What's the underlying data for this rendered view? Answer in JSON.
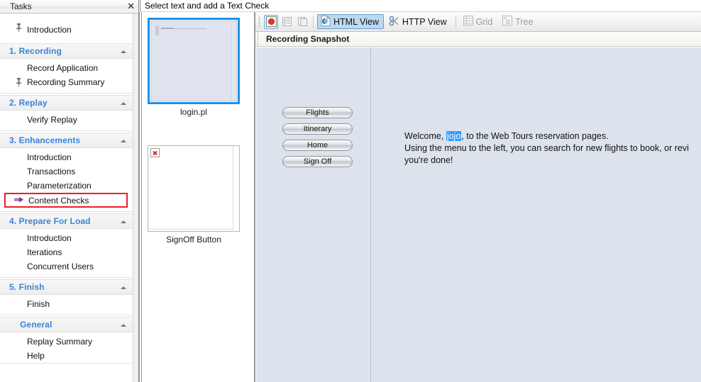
{
  "tasks_pane": {
    "title": "Tasks",
    "close_icon": "close-icon",
    "items_flat": [
      {
        "label": "Introduction",
        "icon": "pin-icon",
        "type": "item"
      }
    ],
    "groups": [
      {
        "title": "1. Recording",
        "collapse_icon": "chevron-up-icon",
        "items": [
          {
            "label": "Record Application",
            "icon": ""
          },
          {
            "label": "Recording Summary",
            "icon": "pin-icon"
          }
        ]
      },
      {
        "title": "2. Replay",
        "collapse_icon": "chevron-up-icon",
        "items": [
          {
            "label": "Verify Replay",
            "icon": ""
          }
        ]
      },
      {
        "title": "3. Enhancements",
        "collapse_icon": "chevron-up-icon",
        "items": [
          {
            "label": "Introduction",
            "icon": ""
          },
          {
            "label": "Transactions",
            "icon": ""
          },
          {
            "label": "Parameterization",
            "icon": ""
          },
          {
            "label": "Content Checks",
            "icon": "arrow-right-icon",
            "highlighted": true
          }
        ]
      },
      {
        "title": "4. Prepare For Load",
        "collapse_icon": "chevron-up-icon",
        "items": [
          {
            "label": "Introduction",
            "icon": ""
          },
          {
            "label": "Iterations",
            "icon": ""
          },
          {
            "label": "Concurrent Users",
            "icon": ""
          }
        ]
      },
      {
        "title": "5. Finish",
        "collapse_icon": "chevron-up-icon",
        "items": [
          {
            "label": "Finish",
            "icon": ""
          }
        ]
      },
      {
        "title": "General",
        "collapse_icon": "chevron-up-icon",
        "indented": true,
        "items": [
          {
            "label": "Replay Summary",
            "icon": ""
          },
          {
            "label": "Help",
            "icon": ""
          }
        ]
      }
    ]
  },
  "instruction_bar": {
    "text": "Select text and add a Text Check"
  },
  "thumbnails": [
    {
      "label": "login.pl",
      "selected": true,
      "broken": false
    },
    {
      "label": "SignOff Button",
      "selected": false,
      "broken": true
    }
  ],
  "viewer": {
    "toolbar": {
      "icon_buttons": [
        {
          "name": "snapshot-record-icon",
          "active": true
        },
        {
          "name": "split-view-icon",
          "active": false
        },
        {
          "name": "copy-snapshot-icon",
          "active": false
        }
      ],
      "tabs": [
        {
          "label": "HTML View",
          "icon": "html-view-icon",
          "selected": true,
          "disabled": false
        },
        {
          "label": "HTTP View",
          "icon": "http-view-icon",
          "selected": false,
          "disabled": false
        },
        {
          "label": "Grid",
          "icon": "grid-icon",
          "selected": false,
          "disabled": true
        },
        {
          "label": "Tree",
          "icon": "tree-icon",
          "selected": false,
          "disabled": true
        }
      ]
    },
    "snapshot_title": "Recording Snapshot"
  },
  "web_page": {
    "nav_buttons": [
      {
        "label": "Flights"
      },
      {
        "label": "Itinerary"
      },
      {
        "label": "Home"
      },
      {
        "label": "Sign Off"
      }
    ],
    "welcome": {
      "line1_before": "Welcome, ",
      "selected_word": "jojo",
      "line1_after": ", to the Web Tours reservation pages.",
      "line2": "Using the menu to the left, you can search for new flights to book, or revi",
      "line3": "you're done!"
    }
  },
  "colors": {
    "accent_blue": "#3a83d6",
    "highlight_red": "#ee1c25",
    "selection_blue": "#3399ff",
    "tab_selected": "#bcd9f2",
    "page_bg": "#dde3ec"
  }
}
